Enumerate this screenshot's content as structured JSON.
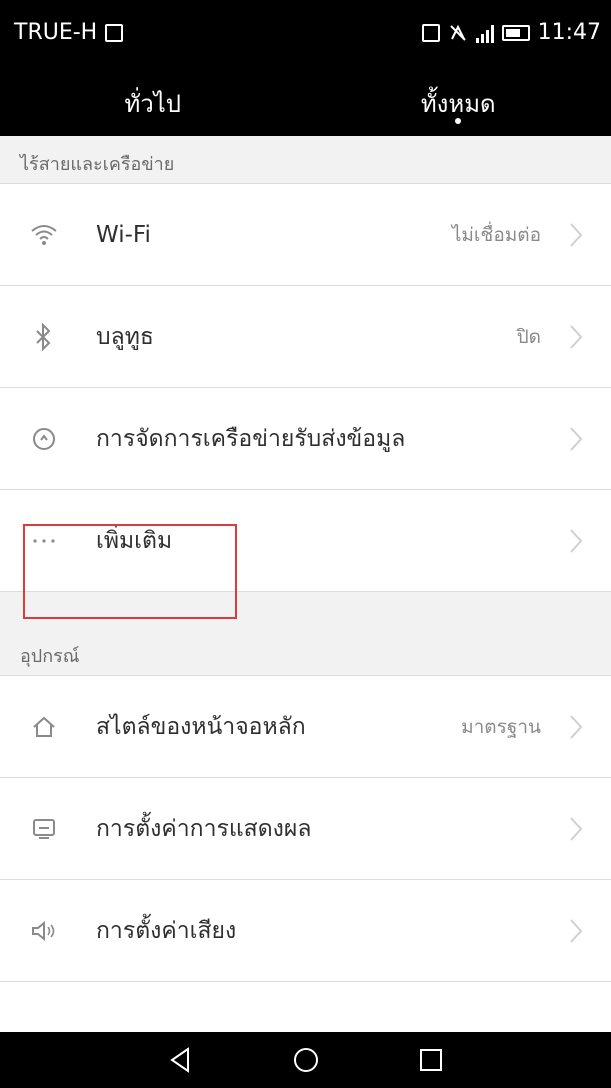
{
  "status_bar": {
    "carrier": "TRUE-H",
    "time": "11:47"
  },
  "tabs": [
    {
      "label": "ทั่วไป",
      "selected": false
    },
    {
      "label": "ทั้งหมด",
      "selected": true
    }
  ],
  "sections": [
    {
      "header": "ไร้สายและเครือข่าย",
      "rows": [
        {
          "icon": "wifi-icon",
          "label": "Wi-Fi",
          "value": "ไม่เชื่อมต่อ"
        },
        {
          "icon": "bluetooth-icon",
          "label": "บลูทูธ",
          "value": "ปิด"
        },
        {
          "icon": "data-usage-icon",
          "label": "การจัดการเครือข่ายรับส่งข้อมูล",
          "value": ""
        },
        {
          "icon": "more-icon",
          "label": "เพิ่มเติม",
          "value": ""
        }
      ]
    },
    {
      "header": "อุปกรณ์",
      "rows": [
        {
          "icon": "home-icon",
          "label": "สไตล์ของหน้าจอหลัก",
          "value": "มาตรฐาน"
        },
        {
          "icon": "display-icon",
          "label": "การตั้งค่าการแสดงผล",
          "value": ""
        },
        {
          "icon": "sound-icon",
          "label": "การตั้งค่าเสียง",
          "value": ""
        }
      ]
    }
  ],
  "nav": {
    "back": "back-icon",
    "home": "home-circle-icon",
    "recents": "recents-icon"
  },
  "colors": {
    "bar_bg": "#000000",
    "highlight": "#e03a3a",
    "row_bg": "#ffffff",
    "section_bg": "#f2f2f2"
  }
}
